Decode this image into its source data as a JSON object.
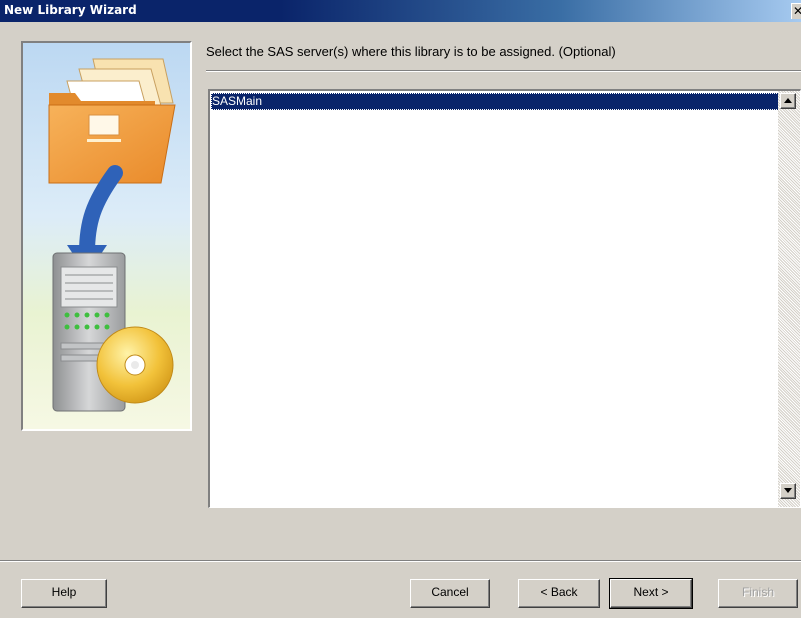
{
  "window": {
    "title": "New Library Wizard",
    "close_glyph": "✕"
  },
  "instruction": "Select the SAS server(s) where this library is to be assigned. (Optional)",
  "server_list": {
    "items": [
      "SASMain"
    ],
    "selected_index": 0
  },
  "buttons": {
    "help": "Help",
    "cancel": "Cancel",
    "back": "< Back",
    "next": "Next >",
    "finish": "Finish"
  },
  "icons": {
    "art": "folder-to-server-illustration",
    "scroll_up": "arrow-up-icon",
    "scroll_down": "arrow-down-icon",
    "close": "close-icon"
  },
  "colors": {
    "title_bar": "#0a246a",
    "selection": "#0a246a",
    "dialog_face": "#d4d0c8",
    "folder": "#f5a84a",
    "arrow": "#2f62b8",
    "disc": "#f2c23a"
  }
}
